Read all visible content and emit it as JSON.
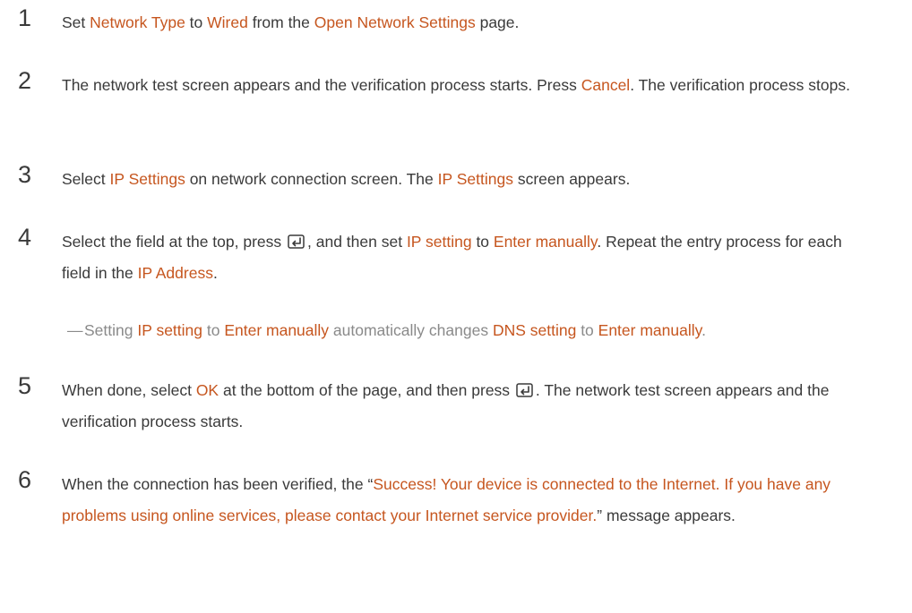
{
  "steps": [
    {
      "number": "1",
      "parts": [
        {
          "t": "Set "
        },
        {
          "t": "Network Type",
          "hl": true
        },
        {
          "t": " to "
        },
        {
          "t": "Wired",
          "hl": true
        },
        {
          "t": " from the "
        },
        {
          "t": "Open Network Settings",
          "hl": true
        },
        {
          "t": " page."
        }
      ]
    },
    {
      "number": "2",
      "parts": [
        {
          "t": "The network test screen appears and the verification process starts. Press "
        },
        {
          "t": "Cancel",
          "hl": true
        },
        {
          "t": ". The verification process stops."
        }
      ]
    },
    {
      "number": "3",
      "parts": [
        {
          "t": "Select "
        },
        {
          "t": "IP Settings",
          "hl": true
        },
        {
          "t": " on network connection screen. The "
        },
        {
          "t": "IP Settings",
          "hl": true
        },
        {
          "t": " screen appears."
        }
      ]
    },
    {
      "number": "4",
      "parts": [
        {
          "t": "Select the field at the top, press "
        },
        {
          "icon": "enter-icon"
        },
        {
          "t": ", and then set "
        },
        {
          "t": "IP setting",
          "hl": true
        },
        {
          "t": " to "
        },
        {
          "t": "Enter manually",
          "hl": true
        },
        {
          "t": ". Repeat the entry process for each field in the "
        },
        {
          "t": "IP Address",
          "hl": true
        },
        {
          "t": "."
        }
      ]
    },
    {
      "number": "5",
      "parts": [
        {
          "t": "When done, select "
        },
        {
          "t": "OK",
          "hl": true
        },
        {
          "t": " at the bottom of the page, and then press "
        },
        {
          "icon": "enter-icon"
        },
        {
          "t": ". The network test screen appears and the verification process starts."
        }
      ]
    },
    {
      "number": "6",
      "parts": [
        {
          "t": "When the connection has been verified, the “"
        },
        {
          "t": "Success! Your device is connected to the Internet. If you have any problems using online services, please contact your Internet service provider.",
          "hl": true
        },
        {
          "t": "” message appears."
        }
      ]
    }
  ],
  "note": {
    "dash": "—",
    "parts": [
      {
        "t": "Setting "
      },
      {
        "t": "IP setting",
        "hl": true
      },
      {
        "t": " to "
      },
      {
        "t": "Enter manually",
        "hl": true
      },
      {
        "t": " automatically changes "
      },
      {
        "t": "DNS setting",
        "hl": true
      },
      {
        "t": " to "
      },
      {
        "t": "Enter manually",
        "hl": true
      },
      {
        "t": "."
      }
    ]
  },
  "colors": {
    "highlight": "#c6561f",
    "body_text": "#3a3a3a",
    "note_text": "#8a8a8a"
  },
  "icons": [
    "enter-icon"
  ]
}
